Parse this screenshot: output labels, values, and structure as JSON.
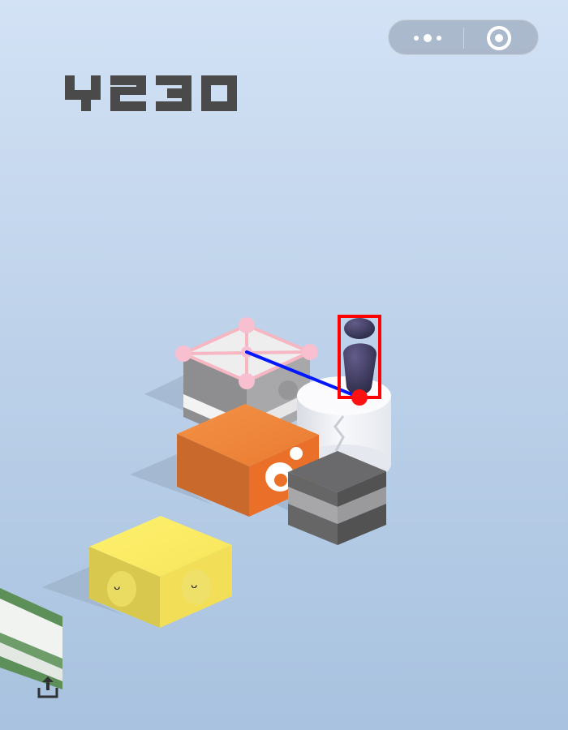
{
  "game": {
    "score": "4230"
  },
  "capsule": {
    "more_icon": "more-dots-icon",
    "close_icon": "target-circle-icon"
  },
  "share": {
    "icon": "share-upload-icon"
  },
  "colors": {
    "score": "#4a4a4a",
    "orange_block": "#f08035",
    "yellow_block": "#f7e15a",
    "player": "#3a3858",
    "trajectory": "#0018ff",
    "highlight_box": "#ff0000",
    "target_outline": "#f6b7c3"
  }
}
